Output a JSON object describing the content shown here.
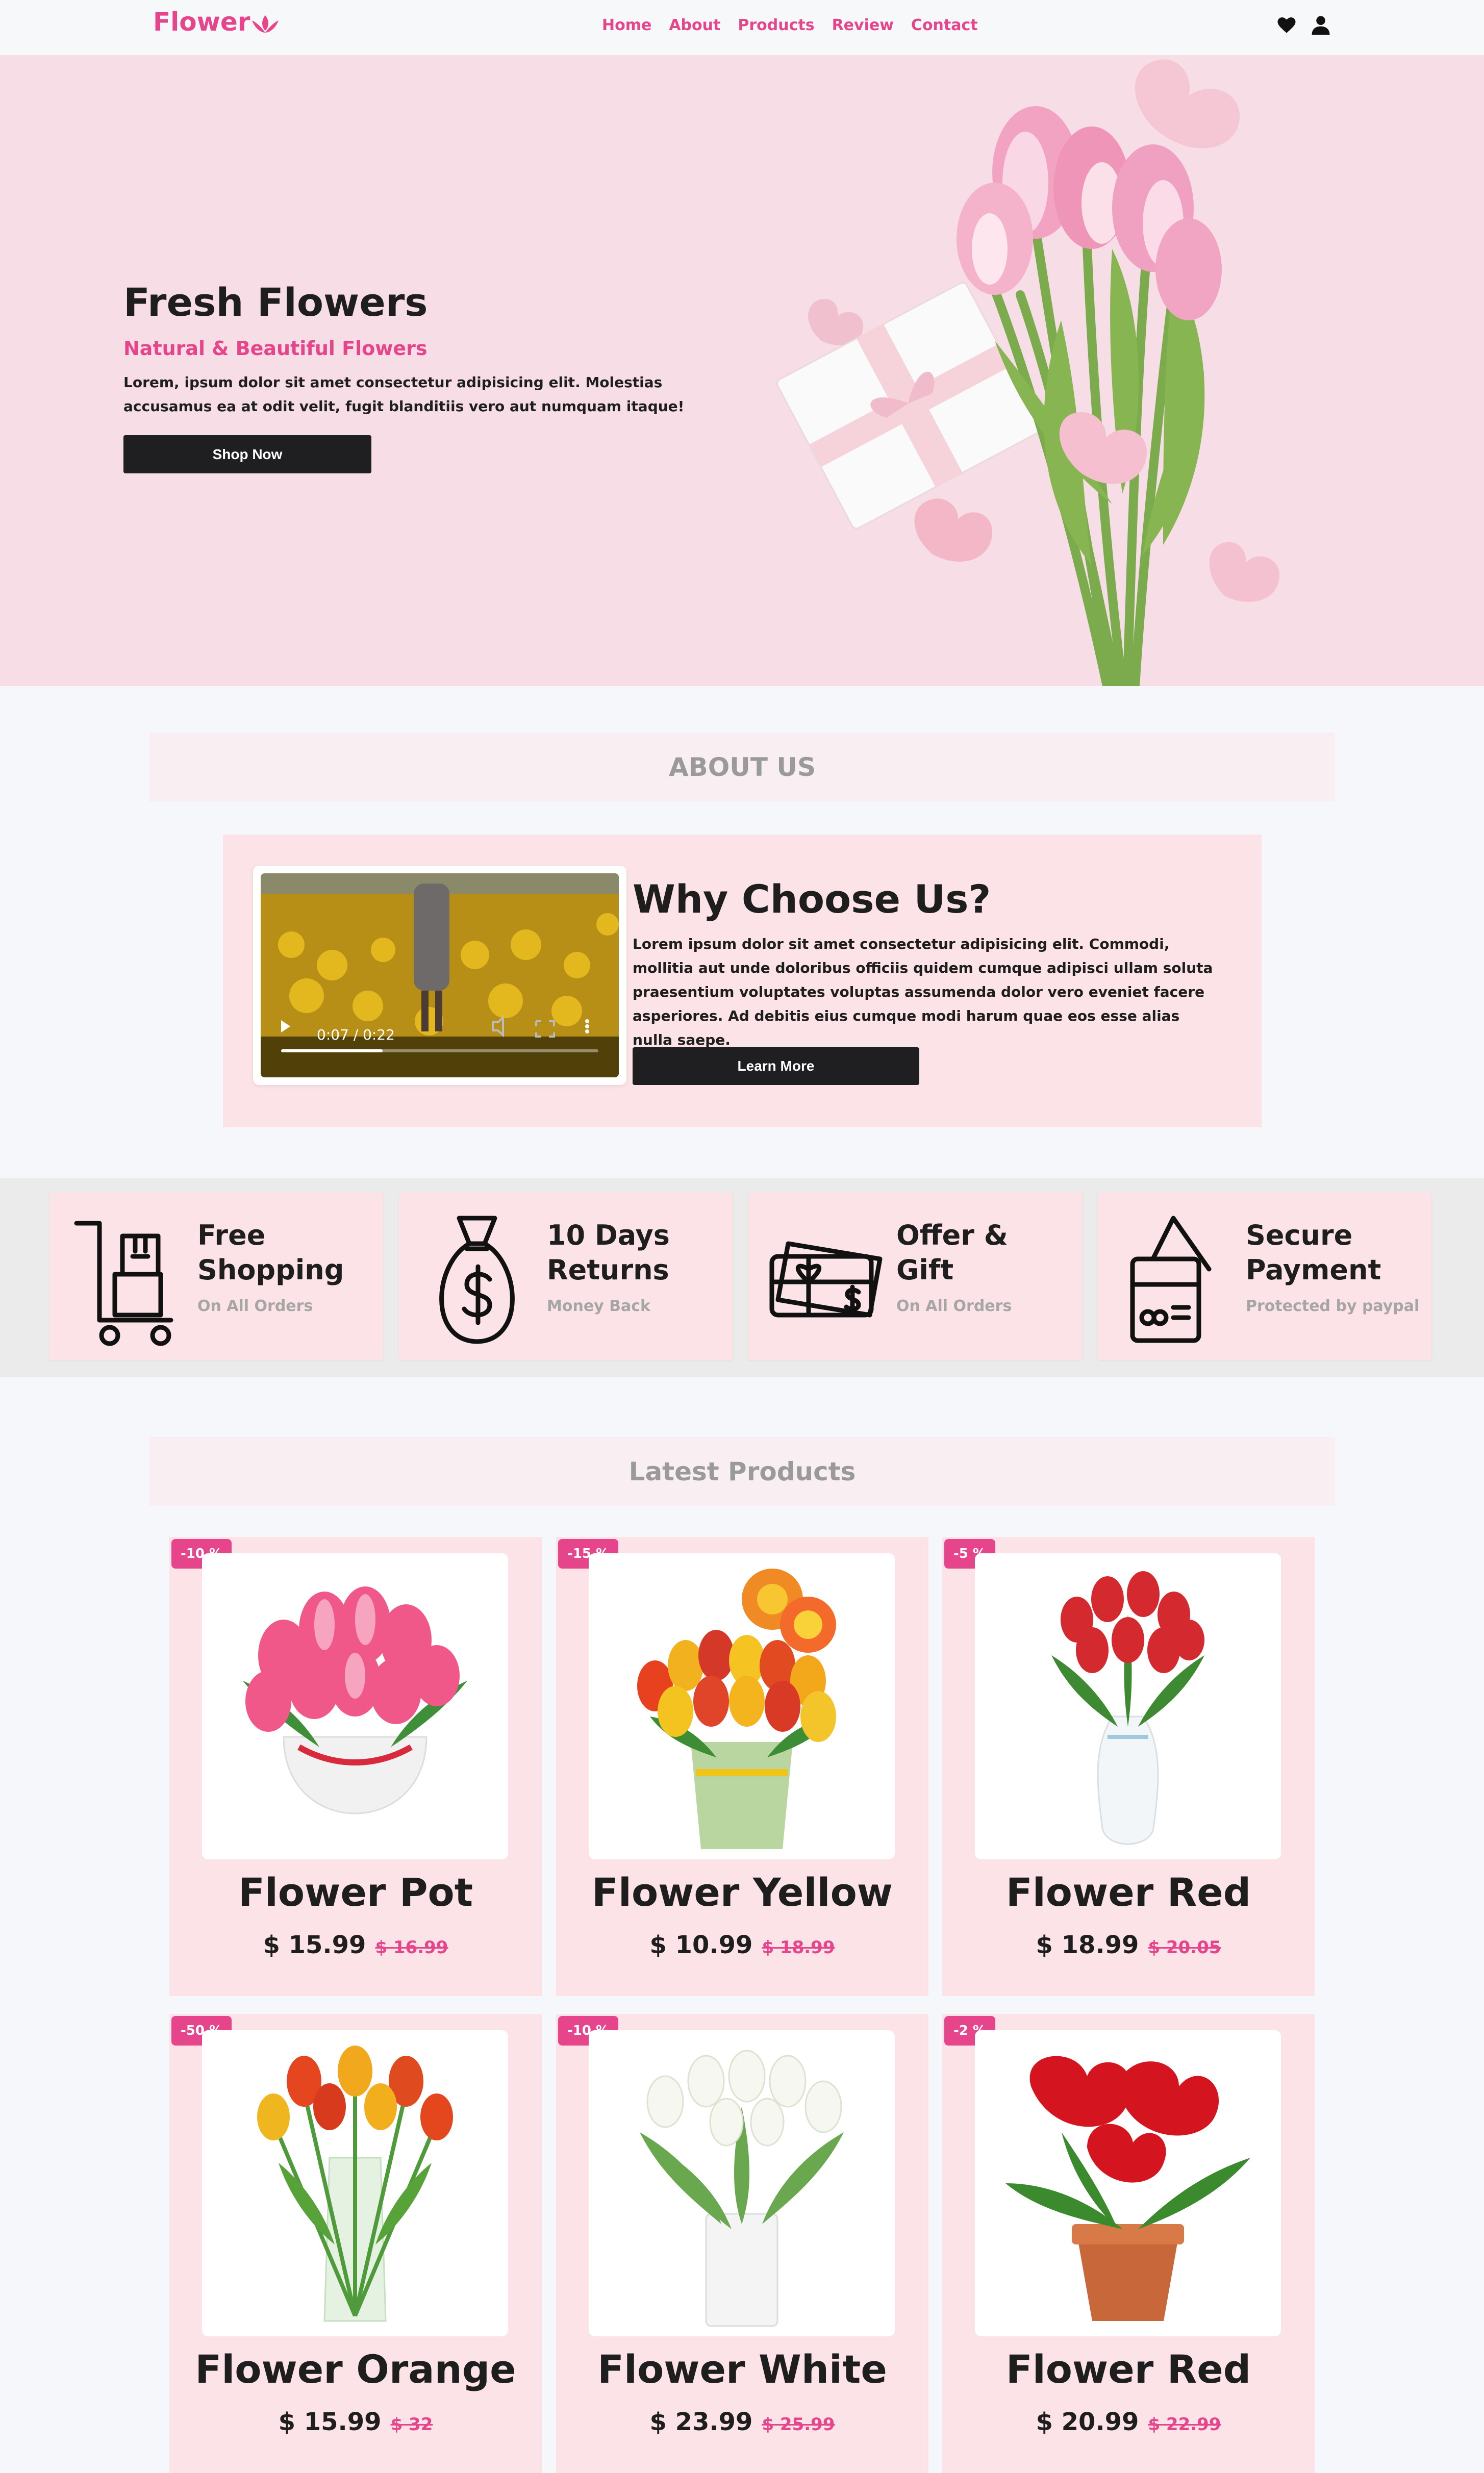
{
  "header": {
    "logo": "Flower",
    "nav": [
      "Home",
      "About",
      "Products",
      "Review",
      "Contact"
    ],
    "icons": [
      "heart-icon",
      "user-icon"
    ]
  },
  "hero": {
    "title": "Fresh Flowers",
    "subtitle": "Natural & Beautiful Flowers",
    "text": "Lorem, ipsum dolor sit amet consectetur adipisicing elit. Molestias accusamus ea at odit velit, fugit blanditiis vero aut numquam itaque!",
    "button": "Shop Now"
  },
  "about": {
    "heading": "ABOUT US",
    "video_time": "0:07 / 0:22",
    "title": "Why Choose Us?",
    "text": "Lorem ipsum dolor sit amet consectetur adipisicing elit. Commodi, mollitia aut unde doloribus officiis quidem cumque adipisci ullam soluta praesentium voluptates voluptas assumenda dolor vero eveniet facere asperiores. Ad debitis eius cumque modi harum quae eos esse alias nulla saepe.",
    "button": "Learn More",
    "video_progress": 0.32
  },
  "features": [
    {
      "title_1": "Free",
      "title_2": "Shopping",
      "sub": "On All Orders",
      "icon": "cart-icon"
    },
    {
      "title_1": "10 Days",
      "title_2": "Returns",
      "sub": "Money Back",
      "icon": "money-bag-icon"
    },
    {
      "title_1": "Offer &",
      "title_2": "Gift",
      "sub": "On All Orders",
      "icon": "gift-card-icon"
    },
    {
      "title_1": "Secure",
      "title_2": "Payment",
      "sub": "Protected by paypal",
      "icon": "credit-card-icon"
    }
  ],
  "products": {
    "heading": "Latest Products",
    "items": [
      {
        "badge": "-10 %",
        "name": "Flower Pot",
        "price": "$ 15.99",
        "old": "$ 16.99"
      },
      {
        "badge": "-15 %",
        "name": "Flower Yellow",
        "price": "$ 10.99",
        "old": "$ 18.99"
      },
      {
        "badge": "-5 %",
        "name": "Flower Red",
        "price": "$ 18.99",
        "old": "$ 20.05"
      },
      {
        "badge": "-50 %",
        "name": "Flower Orange",
        "price": "$ 15.99",
        "old": "$ 32"
      },
      {
        "badge": "-10 %",
        "name": "Flower White",
        "price": "$ 23.99",
        "old": "$ 25.99"
      },
      {
        "badge": "-2 %",
        "name": "Flower Red",
        "price": "$ 20.99",
        "old": "$ 22.99"
      }
    ]
  },
  "colors": {
    "accent": "#e6458b",
    "hero_bg": "#f7dee6",
    "card_bg": "#fbe3e7",
    "dark_button": "#1f1f21"
  }
}
